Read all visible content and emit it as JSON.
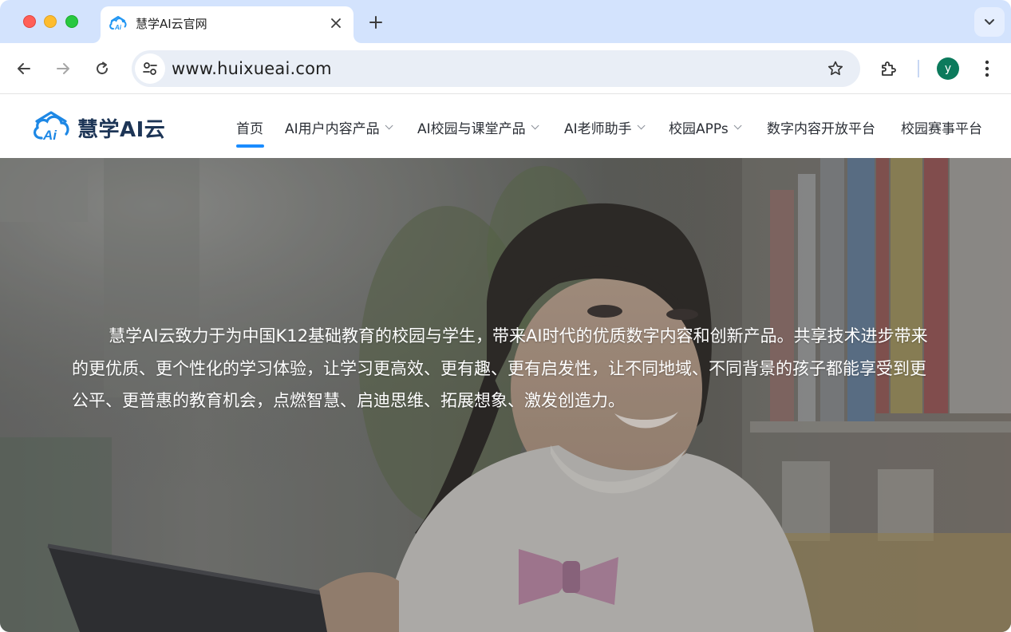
{
  "browser": {
    "tab": {
      "title": "慧学AI云官网",
      "favicon": "cloud-ai-icon"
    },
    "url": "www.huixueai.com",
    "profile_initial": "y",
    "icons": {
      "back": "arrow-left-icon",
      "forward": "arrow-right-icon",
      "reload": "reload-icon",
      "site_info": "tune-icon",
      "bookmark": "star-icon",
      "extensions": "puzzle-icon",
      "menu": "kebab-icon",
      "tab_search": "chevron-down-icon",
      "new_tab": "plus-icon",
      "close_tab": "close-icon"
    }
  },
  "site": {
    "logo_text": "慧学AI云",
    "nav": [
      {
        "label": "首页",
        "active": true,
        "dropdown": false
      },
      {
        "label": "AI用户内容产品",
        "active": false,
        "dropdown": true
      },
      {
        "label": "AI校园与课堂产品",
        "active": false,
        "dropdown": true
      },
      {
        "label": "AI老师助手",
        "active": false,
        "dropdown": true
      },
      {
        "label": "校园APPs",
        "active": false,
        "dropdown": true
      },
      {
        "label": "数字内容开放平台",
        "active": false,
        "dropdown": false
      },
      {
        "label": "校园赛事平台",
        "active": false,
        "dropdown": false
      }
    ],
    "hero": {
      "text": "慧学AI云致力于为中国K12基础教育的校园与学生，带来AI时代的优质数字内容和创新产品。共享技术进步带来的更优质、更个性化的学习体验，让学习更高效、更有趣、更有启发性，让不同地域、不同背景的孩子都能享受到更公平、更普惠的教育机会，点燃智慧、启迪思维、拓展想象、激发创造力。"
    }
  },
  "colors": {
    "tabstrip": "#d3e3fd",
    "accent": "#1a8cff",
    "logo_text": "#1d3556",
    "avatar": "#0c7a5c"
  }
}
